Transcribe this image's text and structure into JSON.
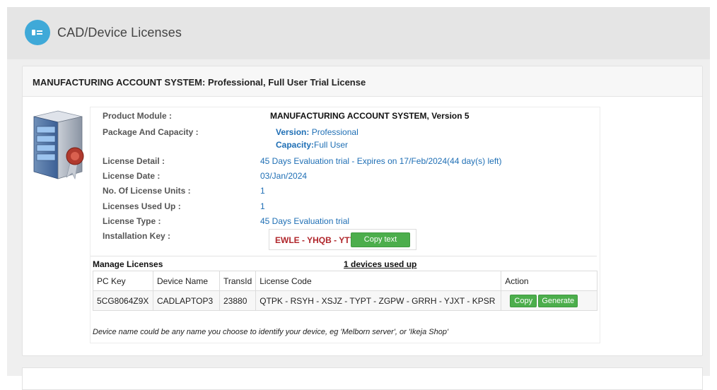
{
  "header": {
    "title": "CAD/Device Licenses",
    "icon": "license-list-icon",
    "accent": "#3fa9d8"
  },
  "card": {
    "title": "MANUFACTURING ACCOUNT SYSTEM: Professional, Full User Trial License",
    "image": "server-certificate-icon"
  },
  "details": {
    "product_module_label": "Product Module :",
    "product_module_value": "MANUFACTURING ACCOUNT SYSTEM, Version 5",
    "package_label": "Package And Capacity :",
    "version_key": "Version:",
    "version_value": " Professional",
    "capacity_key": "Capacity:",
    "capacity_value": "Full User",
    "license_detail_label": "License Detail :",
    "license_detail_value": "45 Days Evaluation trial - Expires on 17/Feb/2024(44 day(s) left)",
    "license_date_label": "License Date :",
    "license_date_value": "03/Jan/2024",
    "units_label": "No. Of License Units :",
    "units_value": "1",
    "used_label": "Licenses Used Up :",
    "used_value": "1",
    "type_label": "License Type :",
    "type_value": "45 Days Evaluation trial",
    "install_key_label": "Installation Key :",
    "install_key_value": "EWLE - YHQB - YTYX",
    "copy_text_label": "Copy text"
  },
  "manage": {
    "title": "Manage Licenses",
    "devices_used": "1 devices used up",
    "columns": [
      "PC Key",
      "Device Name",
      "TransId",
      "License Code",
      "Action"
    ],
    "rows": [
      {
        "pc_key": "5CG8064Z9X",
        "device_name": "CADLAPTOP3",
        "trans_id": "23880",
        "license_code": "QTPK - RSYH - XSJZ - TYPT - ZGPW - GRRH - YJXT - KPSR",
        "copy_label": "Copy",
        "generate_label": "Generate"
      }
    ],
    "note": "Device name could be any name you choose to identify your device, eg 'Melborn server', or 'Ikeja Shop'"
  },
  "colors": {
    "button_green": "#4cae4c",
    "link_blue": "#1f6fb5",
    "key_red": "#b0262b"
  }
}
